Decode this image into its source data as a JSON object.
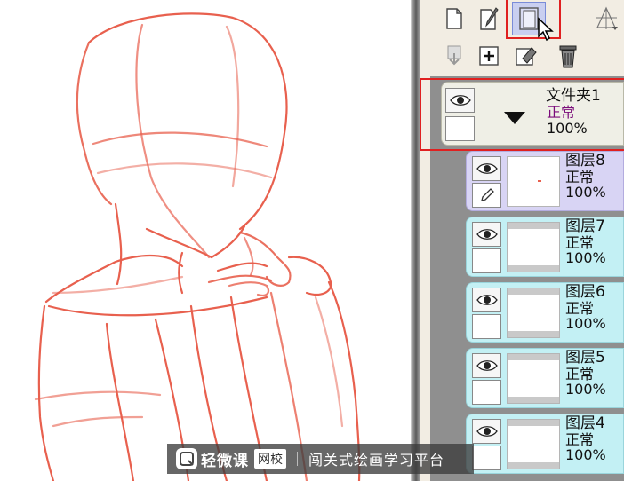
{
  "toolbar": {
    "buttons": [
      {
        "name": "new-layer-icon"
      },
      {
        "name": "new-pen-layer-icon"
      },
      {
        "name": "new-folder-icon",
        "active": true
      },
      {
        "name": "layer-filter-icon"
      },
      {
        "name": "merge-down-icon"
      },
      {
        "name": "add-layer-icon"
      },
      {
        "name": "clear-layer-icon"
      },
      {
        "name": "delete-layer-icon"
      }
    ]
  },
  "folder": {
    "name": "文件夹1",
    "mode": "正常",
    "opacity": "100%"
  },
  "layers": [
    {
      "name": "图层8",
      "mode": "正常",
      "opacity": "100%",
      "selected": true
    },
    {
      "name": "图层7",
      "mode": "正常",
      "opacity": "100%"
    },
    {
      "name": "图层6",
      "mode": "正常",
      "opacity": "100%"
    },
    {
      "name": "图层5",
      "mode": "正常",
      "opacity": "100%"
    },
    {
      "name": "图层4",
      "mode": "正常",
      "opacity": "100%"
    }
  ],
  "watermark": {
    "brand": "轻微课",
    "tag": "网校",
    "slogan": "闯关式绘画学习平台"
  },
  "colors": {
    "sketch": "#e8604e",
    "highlight": "#e02020",
    "layer_bg": "#c3f0f4",
    "selected_bg": "#d8d4f4"
  }
}
